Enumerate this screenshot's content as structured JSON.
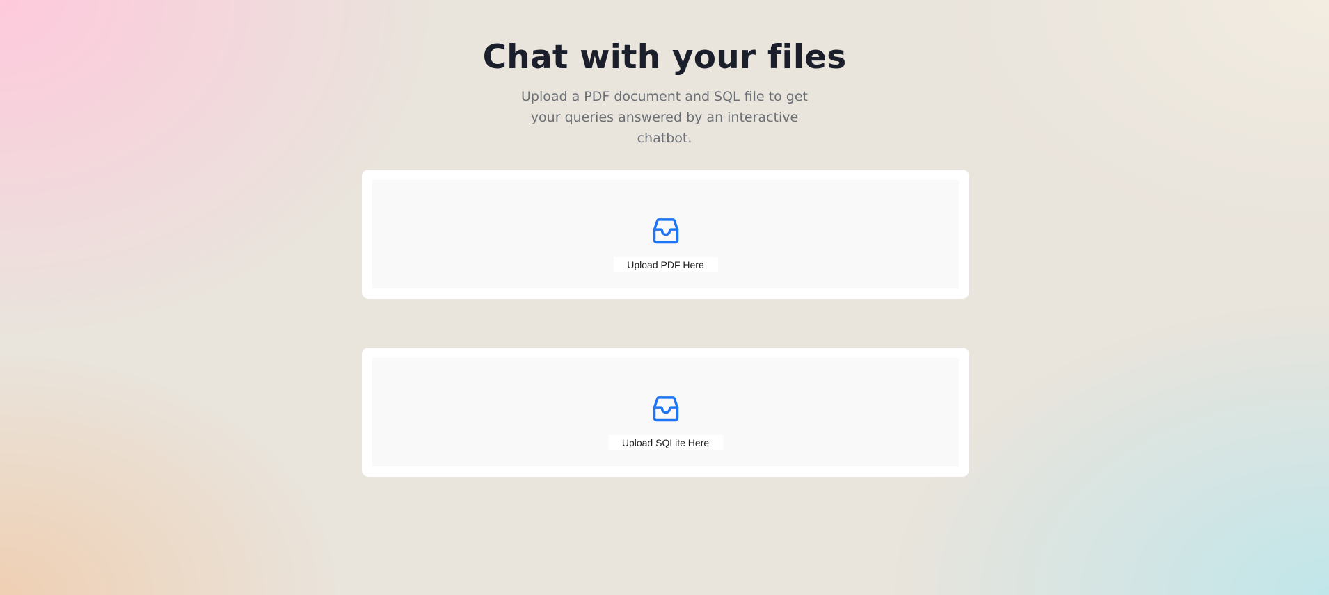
{
  "hero": {
    "title": "Chat with your files",
    "subtitle": "Upload a PDF document and SQL file to get your queries answered by an interactive chatbot."
  },
  "uploads": [
    {
      "label": "Upload PDF Here",
      "icon": "inbox-icon"
    },
    {
      "label": "Upload SQLite Here",
      "icon": "inbox-icon"
    }
  ],
  "colors": {
    "accent": "#1f76f2",
    "title": "#1b1f2b",
    "subtitle": "#6b6f76",
    "card": "#ffffff",
    "dropzone": "#f9f9f9"
  }
}
